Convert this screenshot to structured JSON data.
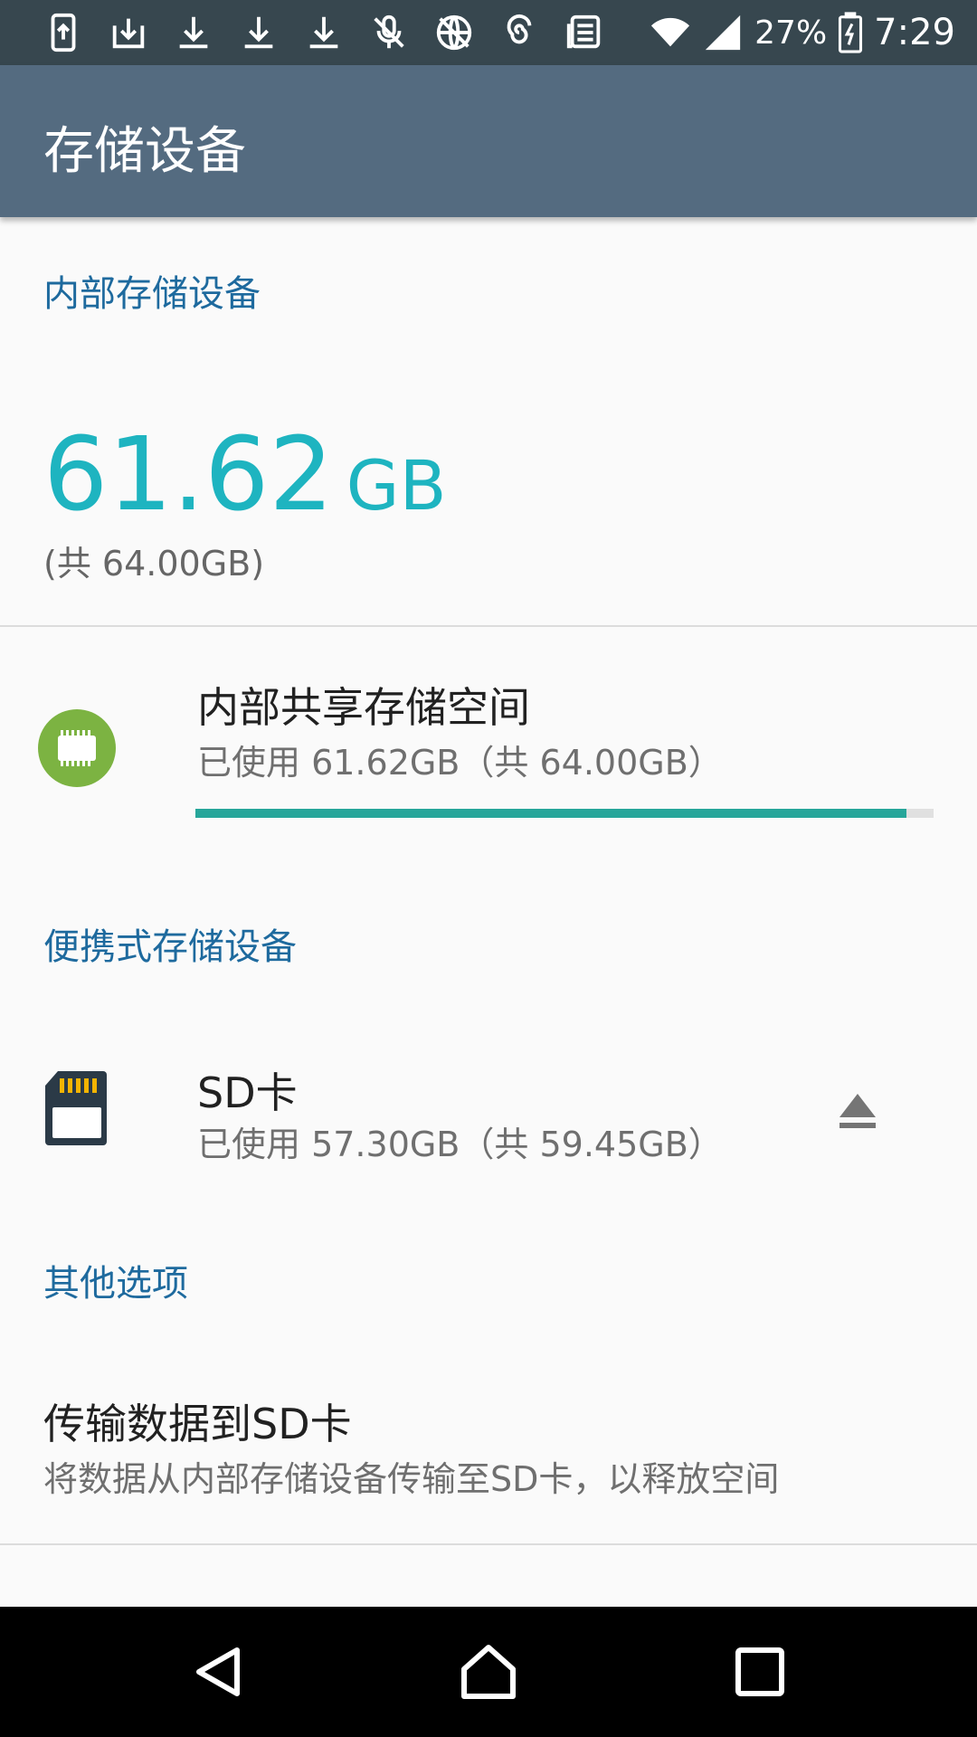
{
  "status_bar": {
    "battery_percent": "27%",
    "time": "7:29",
    "icons": [
      "upload-icon",
      "download-icon",
      "download-icon",
      "download-icon",
      "download-icon",
      "mic-off-icon",
      "globe-off-icon",
      "spiral-icon",
      "news-icon",
      "wifi-icon",
      "signal-icon",
      "battery-icon"
    ]
  },
  "app_bar": {
    "title": "存储设备"
  },
  "internal": {
    "header": "内部存储设备",
    "used_value": "61.62",
    "used_unit": "GB",
    "total": "(共 64.00GB)",
    "item": {
      "title": "内部共享存储空间",
      "subtitle": "已使用 61.62GB（共 64.00GB）",
      "used_fraction": 0.963
    }
  },
  "portable": {
    "header": "便携式存储设备",
    "item": {
      "title": "SD卡",
      "subtitle": "已使用 57.30GB（共 59.45GB）"
    }
  },
  "other": {
    "header": "其他选项",
    "item": {
      "title": "传输数据到SD卡",
      "subtitle": "将数据从内部存储设备传输至SD卡，以释放空间"
    }
  },
  "colors": {
    "accent": "#1eb4c0",
    "header_text": "#1e6a9e",
    "app_bar": "#546b80",
    "progress": "#26a69a",
    "chip": "#7cb342"
  }
}
